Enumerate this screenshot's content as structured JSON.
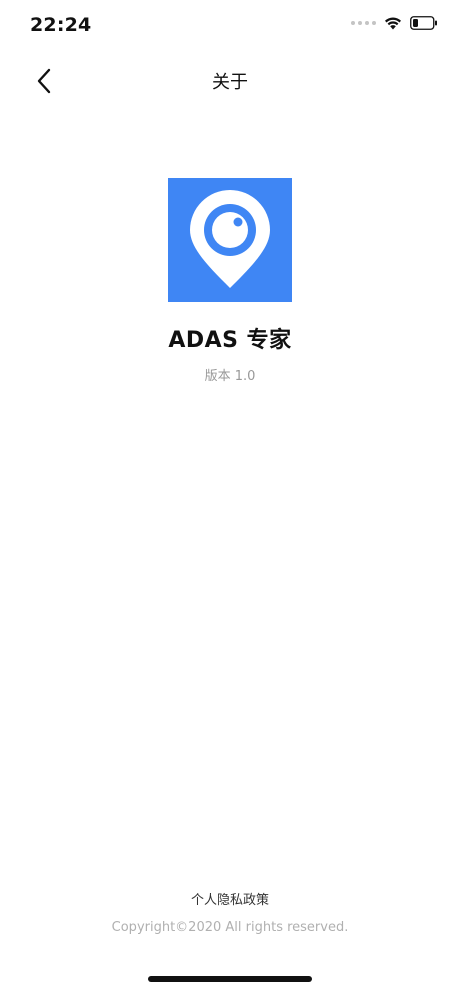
{
  "status_bar": {
    "time": "22:24"
  },
  "nav": {
    "title": "关于"
  },
  "app": {
    "name": "ADAS 专家",
    "version": "版本 1.0",
    "icon": "location-pin-camera-icon",
    "icon_color": "#3f86f4"
  },
  "footer": {
    "privacy": "个人隐私政策",
    "copyright": "Copyright©2020 All rights reserved."
  }
}
